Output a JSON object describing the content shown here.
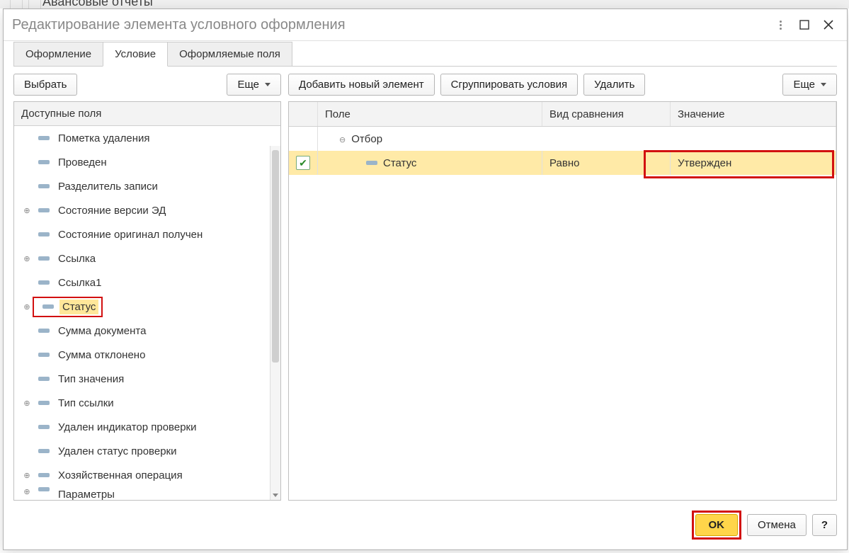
{
  "backdrop_title": "Авансовые отчеты",
  "modal": {
    "title": "Редактирование элемента условного оформления",
    "tabs": [
      "Оформление",
      "Условие",
      "Оформляемые поля"
    ],
    "active_tab_index": 1
  },
  "left": {
    "btn_select": "Выбрать",
    "btn_more": "Еще",
    "header": "Доступные поля",
    "items": [
      {
        "label": "Пометка удаления",
        "expandable": false
      },
      {
        "label": "Проведен",
        "expandable": false
      },
      {
        "label": "Разделитель записи",
        "expandable": false
      },
      {
        "label": "Состояние версии ЭД",
        "expandable": true
      },
      {
        "label": "Состояние оригинал получен",
        "expandable": false
      },
      {
        "label": "Ссылка",
        "expandable": true
      },
      {
        "label": "Ссылка1",
        "expandable": false
      },
      {
        "label": "Статус",
        "expandable": true,
        "selected": true,
        "highlight": true
      },
      {
        "label": "Сумма документа",
        "expandable": false
      },
      {
        "label": "Сумма отклонено",
        "expandable": false
      },
      {
        "label": "Тип значения",
        "expandable": false
      },
      {
        "label": "Тип ссылки",
        "expandable": true
      },
      {
        "label": "Удален индикатор проверки",
        "expandable": false
      },
      {
        "label": "Удален статус проверки",
        "expandable": false
      },
      {
        "label": "Хозяйственная операция",
        "expandable": true
      },
      {
        "label": "Параметры",
        "expandable": true,
        "cut": true
      }
    ]
  },
  "right": {
    "btn_add": "Добавить новый элемент",
    "btn_group": "Сгруппировать условия",
    "btn_delete": "Удалить",
    "btn_more": "Еще",
    "columns": {
      "field": "Поле",
      "comparison": "Вид сравнения",
      "value": "Значение"
    },
    "group_label": "Отбор",
    "row": {
      "checked": true,
      "field": "Статус",
      "comparison": "Равно",
      "value": "Утвержден"
    }
  },
  "footer": {
    "ok": "OK",
    "cancel": "Отмена",
    "help": "?"
  }
}
